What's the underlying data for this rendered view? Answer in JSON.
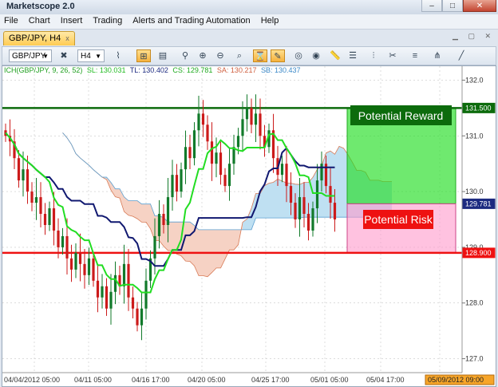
{
  "app": {
    "title": "Marketscope 2.0"
  },
  "window_buttons": {
    "min": "–",
    "max": "□",
    "close": "✕"
  },
  "menu": [
    "File",
    "Chart",
    "Insert",
    "Trading",
    "Alerts and Trading Automation",
    "Help"
  ],
  "tab": {
    "label": "GBP/JPY, H4",
    "close": "x"
  },
  "toolbar": {
    "symbol": "GBP/JPY",
    "timeframe": "H4",
    "caret": "▼"
  },
  "indicator": {
    "name": "ICH(GBP/JPY, 9, 26, 52)",
    "values": [
      {
        "label": "SL: 130.031",
        "color": "#22bb22"
      },
      {
        "label": "TL: 130.402",
        "color": "#1c2a80"
      },
      {
        "label": "CS: 129.781",
        "color": "#1faa1f"
      },
      {
        "label": "SA: 130.217",
        "color": "#d06040"
      },
      {
        "label": "SB: 130.437",
        "color": "#3a88c8"
      }
    ]
  },
  "annotations": {
    "reward": "Potential Reward",
    "risk": "Potential Risk"
  },
  "colors": {
    "kijun": "#101870",
    "tenkan": "#22dd22",
    "resistance": "#0c6b0c",
    "support": "#ee1111"
  },
  "chart_data": {
    "type": "candlestick",
    "instrument": "GBP/JPY",
    "timeframe": "H4",
    "ylim": [
      126.75,
      132.25
    ],
    "y_ticks": [
      127.0,
      128.0,
      129.0,
      130.0,
      131.0,
      132.0
    ],
    "y_tick_labels": [
      "127.0",
      "128.0",
      "129.0",
      "130.0",
      "131.0",
      "132.0"
    ],
    "x_tick_labels": [
      "04/04/2012 05:00",
      "04/11 05:00",
      "04/16 17:00",
      "04/20 05:00",
      "04/25 17:00",
      "05/01 05:00",
      "05/04 17:00",
      "05/"
    ],
    "x_last_label": "05/09/2012 09:00",
    "price_markers": [
      {
        "label": "131.500",
        "value": 131.5,
        "color": "#0c6b0c"
      },
      {
        "label": "129.781",
        "value": 129.781,
        "color": "#1c2a80"
      },
      {
        "label": "128.900",
        "value": 128.9,
        "color": "#ee1111"
      }
    ],
    "levels": {
      "resistance": 131.5,
      "support": 128.9,
      "entry": 129.781
    },
    "boxes": {
      "reward": {
        "from": 129.781,
        "to": 131.5
      },
      "risk": {
        "from": 128.9,
        "to": 129.781
      }
    },
    "close": [
      131.0,
      130.9,
      130.6,
      130.2,
      130.4,
      130.0,
      129.8,
      129.9,
      129.6,
      129.4,
      129.7,
      129.3,
      129.0,
      129.2,
      128.8,
      128.6,
      128.9,
      128.7,
      128.5,
      128.8,
      128.4,
      128.1,
      128.3,
      127.9,
      128.2,
      128.5,
      128.3,
      128.7,
      128.1,
      127.9,
      127.6,
      127.9,
      128.4,
      128.8,
      129.2,
      129.6,
      129.4,
      129.9,
      130.3,
      130.0,
      130.4,
      130.8,
      130.6,
      131.1,
      131.4,
      131.2,
      130.9,
      130.5,
      130.7,
      130.3,
      130.1,
      130.5,
      130.8,
      131.0,
      131.3,
      131.5,
      131.2,
      131.4,
      131.0,
      130.8,
      131.1,
      130.6,
      130.3,
      130.5,
      130.1,
      129.8,
      129.5,
      129.9,
      129.6,
      129.3,
      129.7,
      130.2,
      130.5,
      130.1,
      129.8,
      129.5
    ]
  }
}
